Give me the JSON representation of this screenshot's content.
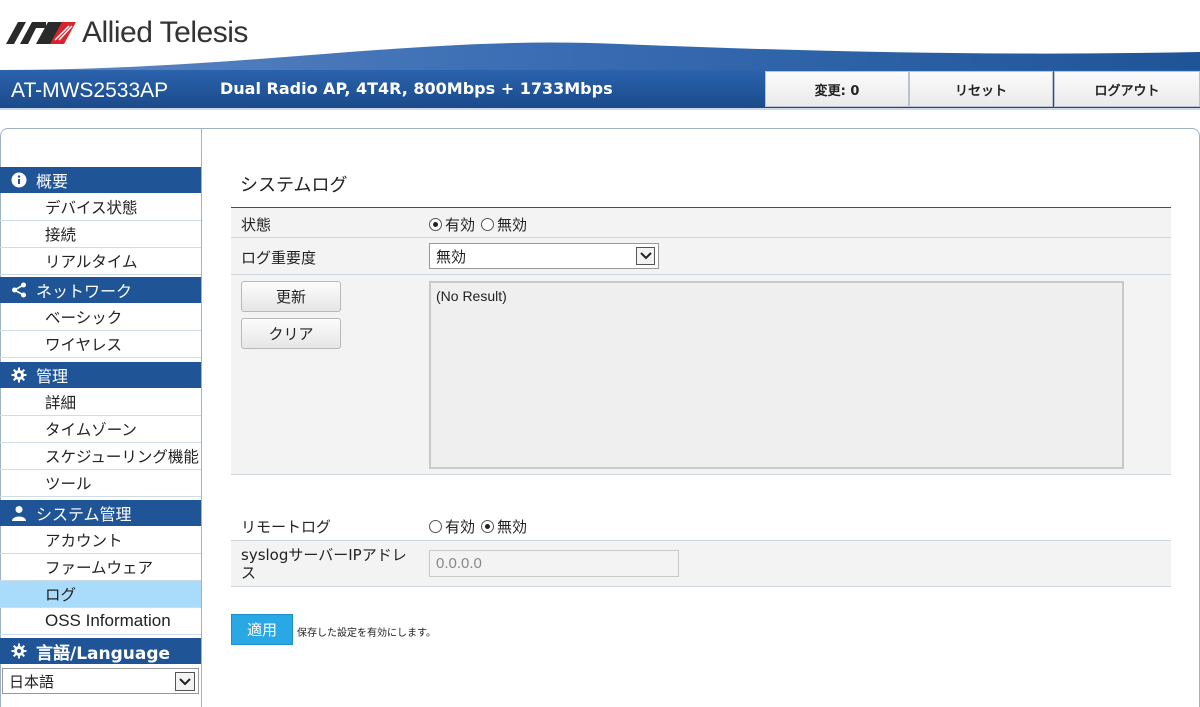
{
  "header": {
    "brand": "Allied Telesis",
    "model": "AT-MWS2533AP",
    "description": "Dual Radio AP, 4T4R, 800Mbps + 1733Mbps",
    "buttons": {
      "changes": "変更: 0",
      "reset": "リセット",
      "logout": "ログアウト"
    },
    "colors": {
      "primary": "#1f5497",
      "accent": "#2aa7e5",
      "logo_red": "#d9232e"
    }
  },
  "sidebar": {
    "sections": [
      {
        "title": "概要",
        "icon": "info-icon",
        "items": [
          "デバイス状態",
          "接続",
          "リアルタイム"
        ]
      },
      {
        "title": "ネットワーク",
        "icon": "share-icon",
        "items": [
          "ベーシック",
          "ワイヤレス"
        ]
      },
      {
        "title": "管理",
        "icon": "gear-icon",
        "items": [
          "詳細",
          "タイムゾーン",
          "スケジューリング機能",
          "ツール"
        ]
      },
      {
        "title": "システム管理",
        "icon": "user-icon",
        "items": [
          "アカウント",
          "ファームウェア",
          "ログ",
          "OSS Information"
        ]
      },
      {
        "title": "言語/Language",
        "icon": "gear-icon",
        "items": []
      }
    ],
    "active_item": "ログ",
    "language_value": "日本語"
  },
  "main": {
    "title": "システムログ",
    "status": {
      "label": "状態",
      "options": [
        "有効",
        "無効"
      ],
      "selected": "有効"
    },
    "severity": {
      "label": "ログ重要度",
      "value": "無効"
    },
    "buttons": {
      "refresh": "更新",
      "clear": "クリア"
    },
    "log_text": "(No Result)",
    "remote_log": {
      "label": "リモートログ",
      "options": [
        "有効",
        "無効"
      ],
      "selected": "無効"
    },
    "syslog": {
      "label": "syslogサーバーIPアドレス",
      "value": "0.0.0.0"
    },
    "apply": {
      "label": "適用",
      "note": "保存した設定を有効にします。"
    }
  }
}
